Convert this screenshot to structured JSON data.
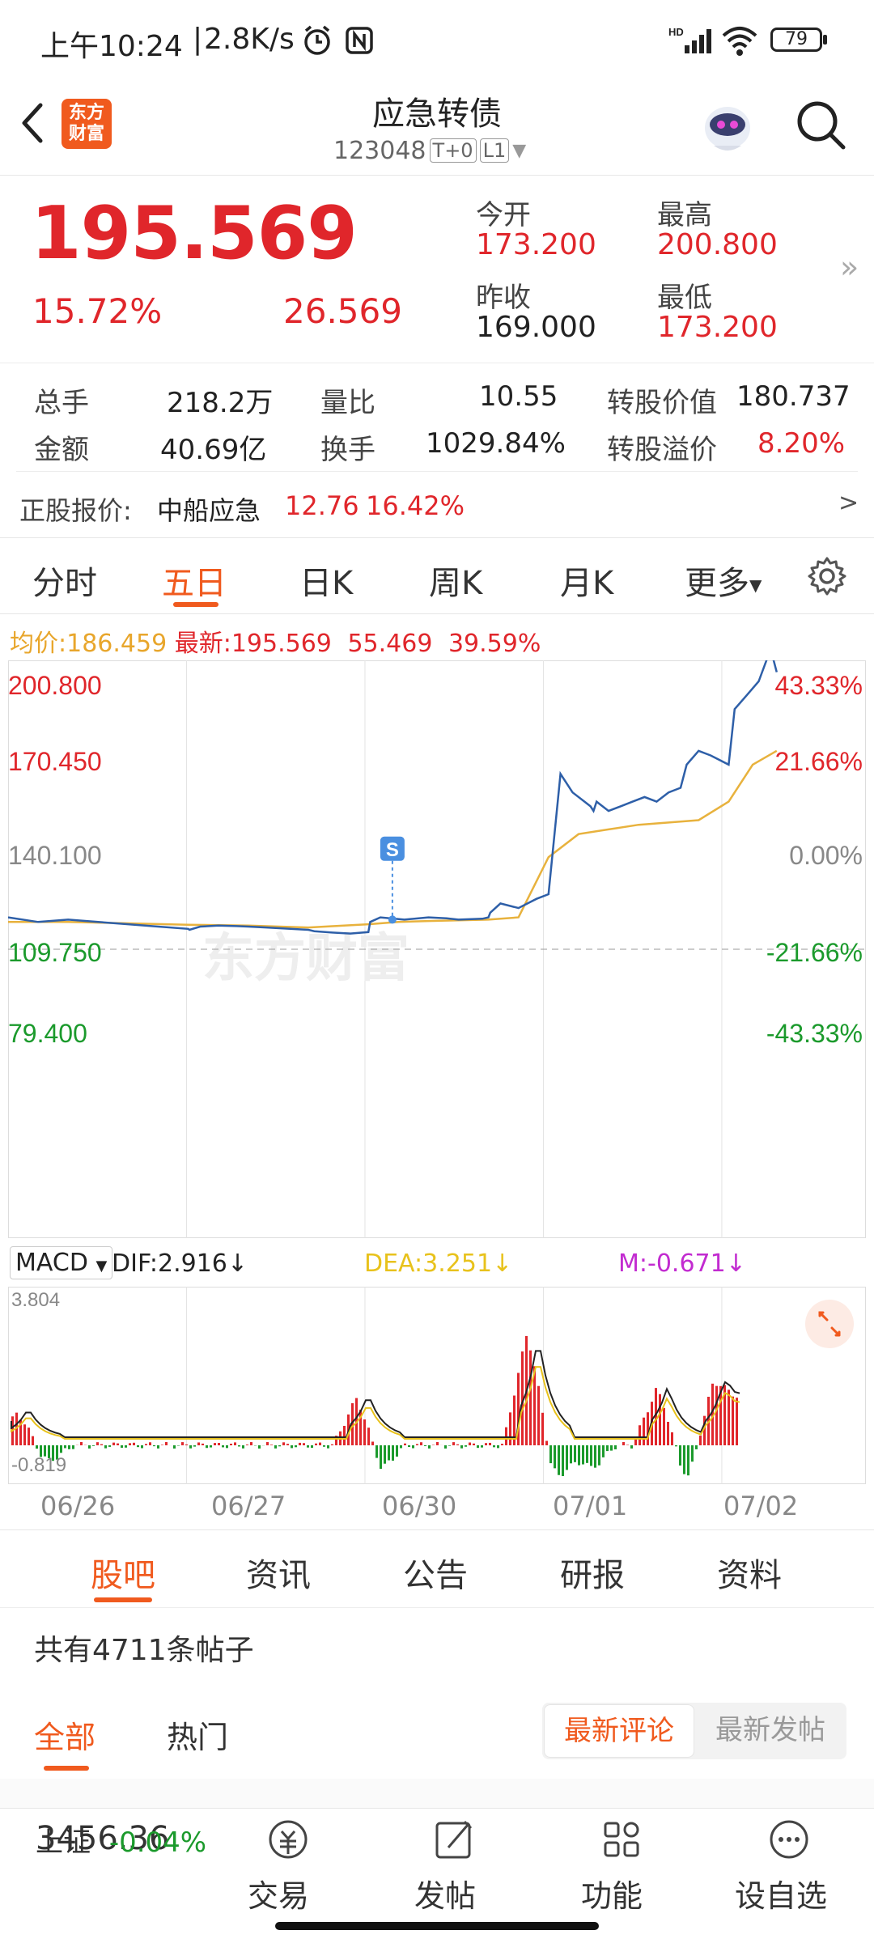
{
  "status_bar": {
    "time": "上午10:24",
    "speed": "2.8K/s",
    "battery": "79"
  },
  "header": {
    "title": "应急转债",
    "code": "123048",
    "tag1": "T+0",
    "tag2": "L1",
    "logo_top": "东方",
    "logo_bottom": "财富"
  },
  "quote": {
    "price": "195.569",
    "change_pct": "15.72%",
    "change_amt": "26.569",
    "open_label": "今开",
    "open": "173.200",
    "high_label": "最高",
    "high": "200.800",
    "prev_label": "昨收",
    "prev": "169.000",
    "low_label": "最低",
    "low": "173.200"
  },
  "stats": {
    "vol_label": "总手",
    "vol": "218.2万",
    "ratio_label": "量比",
    "ratio": "10.55",
    "conv_value_label": "转股价值",
    "conv_value": "180.737",
    "amount_label": "金额",
    "amount": "40.69亿",
    "turnover_label": "换手",
    "turnover": "1029.84%",
    "premium_label": "转股溢价",
    "premium": "8.20%"
  },
  "underlying": {
    "label": "正股报价:",
    "name": "中船应急",
    "price": "12.76",
    "pct": "16.42%"
  },
  "chart_tabs": [
    "分时",
    "五日",
    "日K",
    "周K",
    "月K",
    "更多"
  ],
  "active_tab": 1,
  "chart_info": {
    "avg_label": "均价:",
    "avg": "186.459",
    "latest_label": "最新:",
    "latest": "195.569",
    "chg": "55.469",
    "pct": "39.59%"
  },
  "chart_data": {
    "type": "line",
    "title": "",
    "x_dates": [
      "06/26",
      "06/27",
      "06/30",
      "07/01",
      "07/02"
    ],
    "y_ticks_left": [
      "200.800",
      "170.450",
      "140.100",
      "109.750",
      "79.400"
    ],
    "y_ticks_right": [
      "43.33%",
      "21.66%",
      "0.00%",
      "-21.66%",
      "-43.33%"
    ],
    "ylim": [
      79.4,
      200.8
    ],
    "reference": 140.1,
    "series": [
      {
        "name": "",
        "color": "#2e5fa8",
        "x": [
          0,
          0.5,
          1,
          1.5,
          2,
          2.5,
          3,
          3.02,
          3.2,
          3.5,
          3.8,
          4.0,
          4.3,
          4.7,
          5.0,
          5.1,
          5.4,
          5.7,
          6.0,
          6.03,
          6.2,
          6.6,
          7.0,
          7.3,
          7.5,
          7.9,
          8.0,
          8.03,
          8.2,
          8.5,
          8.8,
          9.0,
          9.2,
          9.4,
          9.6,
          9.7,
          9.75,
          9.8,
          9.9,
          10.0,
          10.2,
          10.4,
          10.6,
          10.8,
          11.0,
          11.2,
          11.3,
          11.5,
          11.7,
          12.0,
          12.1,
          12.3,
          12.5,
          12.7,
          12.8
        ],
        "y": [
          147,
          146,
          146.5,
          146,
          145.5,
          145,
          144.5,
          144.3,
          145,
          145.2,
          145.1,
          145,
          144.8,
          144.5,
          144.3,
          144,
          143.7,
          143.5,
          143.8,
          146,
          147,
          146.5,
          147,
          146.8,
          146.5,
          146.7,
          147,
          148,
          150,
          149,
          151,
          152,
          178,
          174,
          172,
          171,
          170,
          172,
          171,
          170,
          171,
          172,
          173,
          172,
          174,
          175,
          180,
          183,
          182,
          180,
          192,
          195,
          198,
          205,
          200
        ]
      },
      {
        "name": "",
        "color": "#e8b23d",
        "x": [
          0,
          1,
          2,
          3,
          4,
          5,
          6,
          6.5,
          7,
          8,
          8.5,
          9,
          9.5,
          10,
          10.5,
          11,
          11.5,
          12,
          12.4,
          12.8
        ],
        "y": [
          146,
          146,
          145.7,
          145.4,
          145.2,
          144.8,
          145.5,
          146,
          146.2,
          146.5,
          147,
          160,
          165,
          166,
          167,
          167.5,
          168,
          172,
          180,
          183
        ]
      }
    ],
    "marker_label": "S"
  },
  "macd": {
    "label": "MACD",
    "dif": "DIF:2.916",
    "dea": "DEA:3.251",
    "m": "M:-0.671",
    "top": "3.804",
    "bottom": "-0.819"
  },
  "section_tabs": [
    "股吧",
    "资讯",
    "公告",
    "研报",
    "资料"
  ],
  "posts": {
    "count_text": "共有4711条帖子",
    "filter_all": "全部",
    "filter_hot": "热门",
    "sort_comment": "最新评论",
    "sort_post": "最新发帖"
  },
  "bottom_nav": {
    "index_value": "3456.36",
    "index_name": "上证",
    "index_pct": "-0.04%",
    "trade": "交易",
    "post": "发帖",
    "func": "功能",
    "watch": "设自选"
  }
}
